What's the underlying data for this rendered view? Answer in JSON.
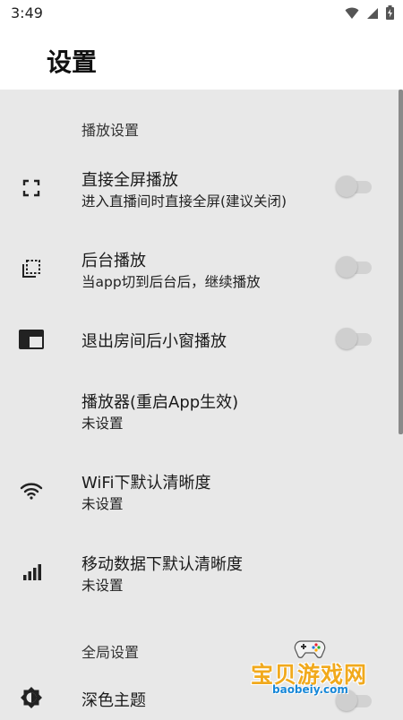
{
  "status_bar": {
    "time": "3:49",
    "icons": [
      "wifi-icon",
      "signal-icon",
      "battery-charging-icon"
    ]
  },
  "app_bar": {
    "title": "设置"
  },
  "sections": {
    "player": {
      "title": "播放设置"
    },
    "global": {
      "title": "全局设置"
    }
  },
  "items": [
    {
      "name": "fullscreen",
      "icon": "fullscreen-icon",
      "title": "直接全屏播放",
      "subtitle": "进入直播间时直接全屏(建议关闭)",
      "switch_on": false
    },
    {
      "name": "background",
      "icon": "background-play-icon",
      "title": "后台播放",
      "subtitle": "当app切到后台后，继续播放",
      "switch_on": false
    },
    {
      "name": "pip",
      "icon": "picture-in-picture-icon",
      "title": "退出房间后小窗播放",
      "switch_on": false
    },
    {
      "name": "player",
      "title": "播放器(重启App生效)",
      "subtitle": "未设置"
    },
    {
      "name": "wifi-quality",
      "icon": "wifi-icon",
      "title": "WiFi下默认清晰度",
      "subtitle": "未设置"
    },
    {
      "name": "mobile-quality",
      "icon": "signal-bars-icon",
      "title": "移动数据下默认清晰度",
      "subtitle": "未设置"
    },
    {
      "name": "dark-theme",
      "icon": "brightness-icon",
      "title": "深色主题",
      "switch_on": false
    }
  ],
  "watermark": {
    "text": "宝贝游戏网",
    "url": "baobeiy.com"
  },
  "colors": {
    "background": "#e8e8e8",
    "appbar": "#ffffff",
    "switch_off": "#cfcfcf",
    "watermark": "#f1a91c",
    "watermark_url": "#1687d8"
  }
}
